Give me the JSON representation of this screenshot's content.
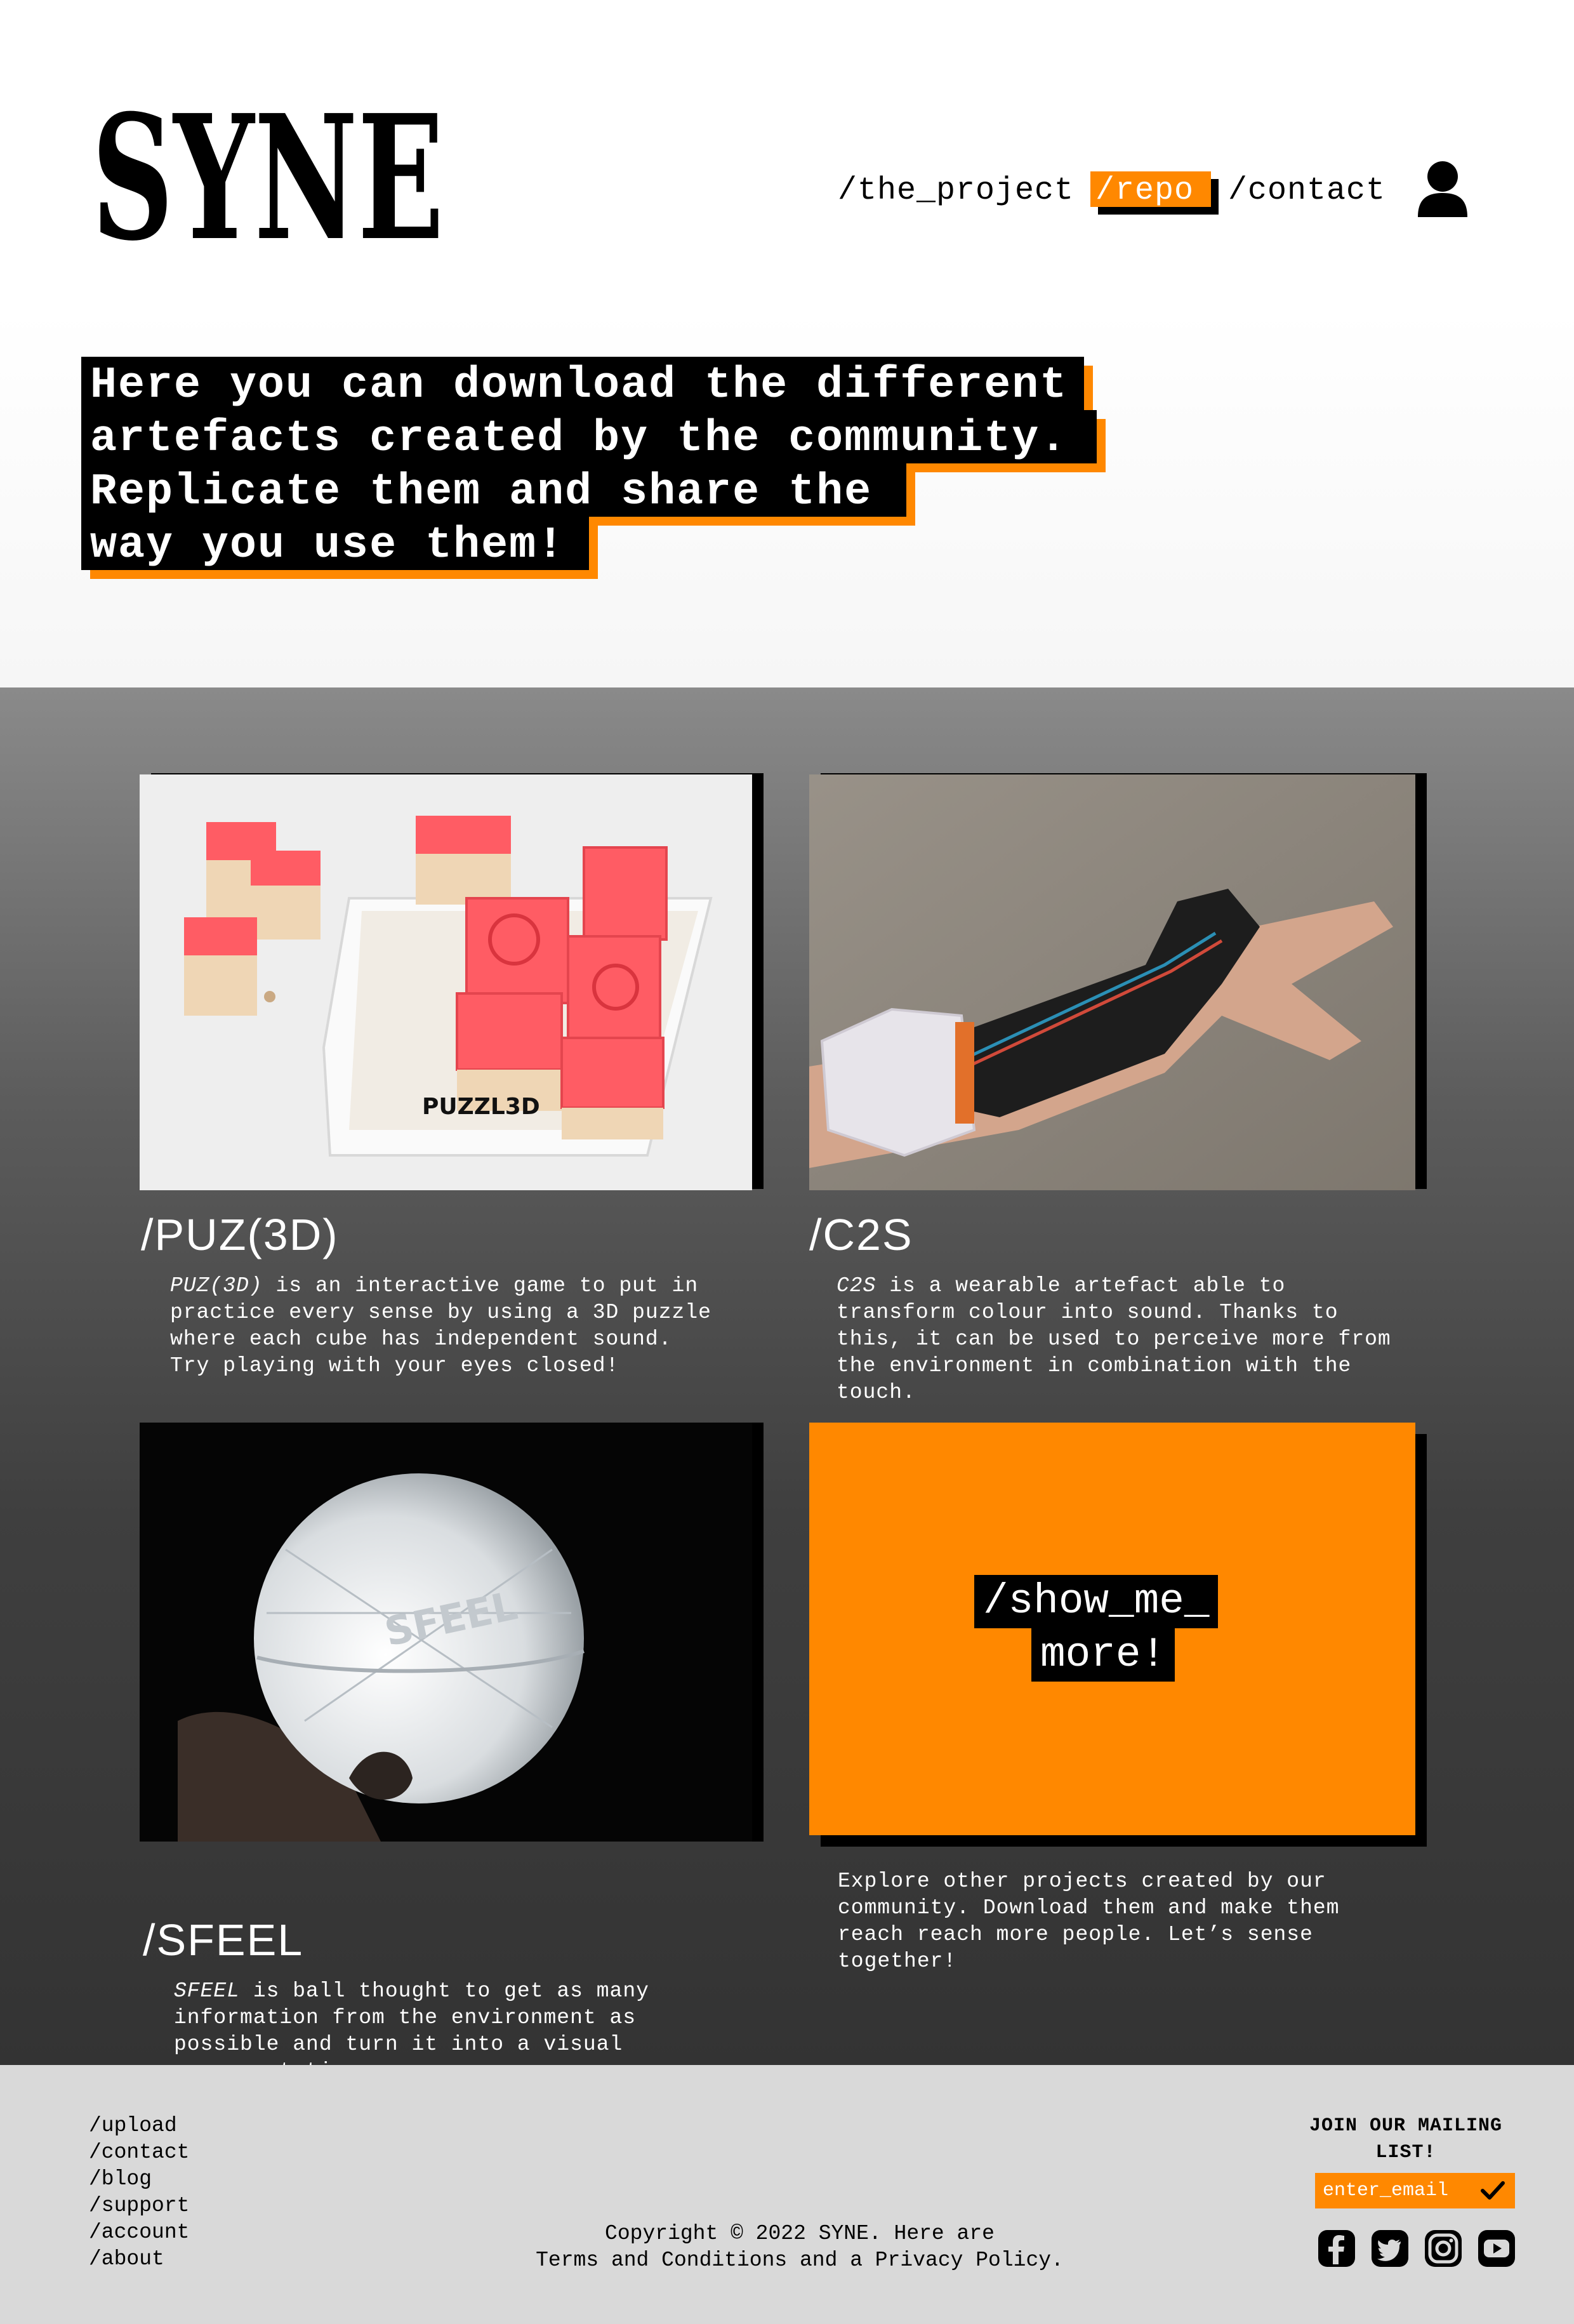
{
  "brand": {
    "logo_text": "SYNE"
  },
  "nav": {
    "items": [
      {
        "label": "/the_project"
      },
      {
        "label": "/repo",
        "active": true
      },
      {
        "label": "/contact"
      }
    ],
    "user_icon": "user-icon"
  },
  "hero": {
    "lines": [
      "Here you can download the different",
      "artefacts created by the community.",
      "Replicate them and share the",
      "way you use them!"
    ]
  },
  "projects": [
    {
      "title": "/PUZ(3D)",
      "name": "PUZ(3D)",
      "description": "is an interactive game to put in practice every sense by using a 3D puzzle where each cube has independent sound. Try playing with your eyes closed!",
      "image_label": "PUZZL3D"
    },
    {
      "title": "/C2S",
      "name": "C2S",
      "description": "is a wearable artefact able to transform colour into sound. Thanks to this, it can be used to perceive more from the environment in combination with the touch."
    },
    {
      "title": "/SFEEL",
      "name": "SFEEL",
      "description": "is ball thought to get as many information from the environment as possible and turn it into a visual representation.",
      "image_label": "SFEEL"
    }
  ],
  "show_more": {
    "line1": "/show_me_",
    "line2": "more!",
    "description": "Explore other projects created by our community. Download them and make them reach reach more people. Let’s sense together!"
  },
  "footer": {
    "links": [
      "/upload",
      "/contact",
      "/blog",
      "/support",
      "/account",
      "/about"
    ],
    "copyright_line1": "Copyright © 2022 SYNE. Here are",
    "copyright_line2": "Terms and Conditions and a Privacy Policy.",
    "mailing_title_line1": "JOIN OUR MAILING",
    "mailing_title_line2": "LIST!",
    "email_placeholder": "enter_email",
    "socials": [
      "facebook-icon",
      "twitter-icon",
      "instagram-icon",
      "youtube-icon"
    ]
  },
  "colors": {
    "accent": "#ff8800",
    "black": "#000000",
    "footer_bg": "#d9d9d9"
  }
}
